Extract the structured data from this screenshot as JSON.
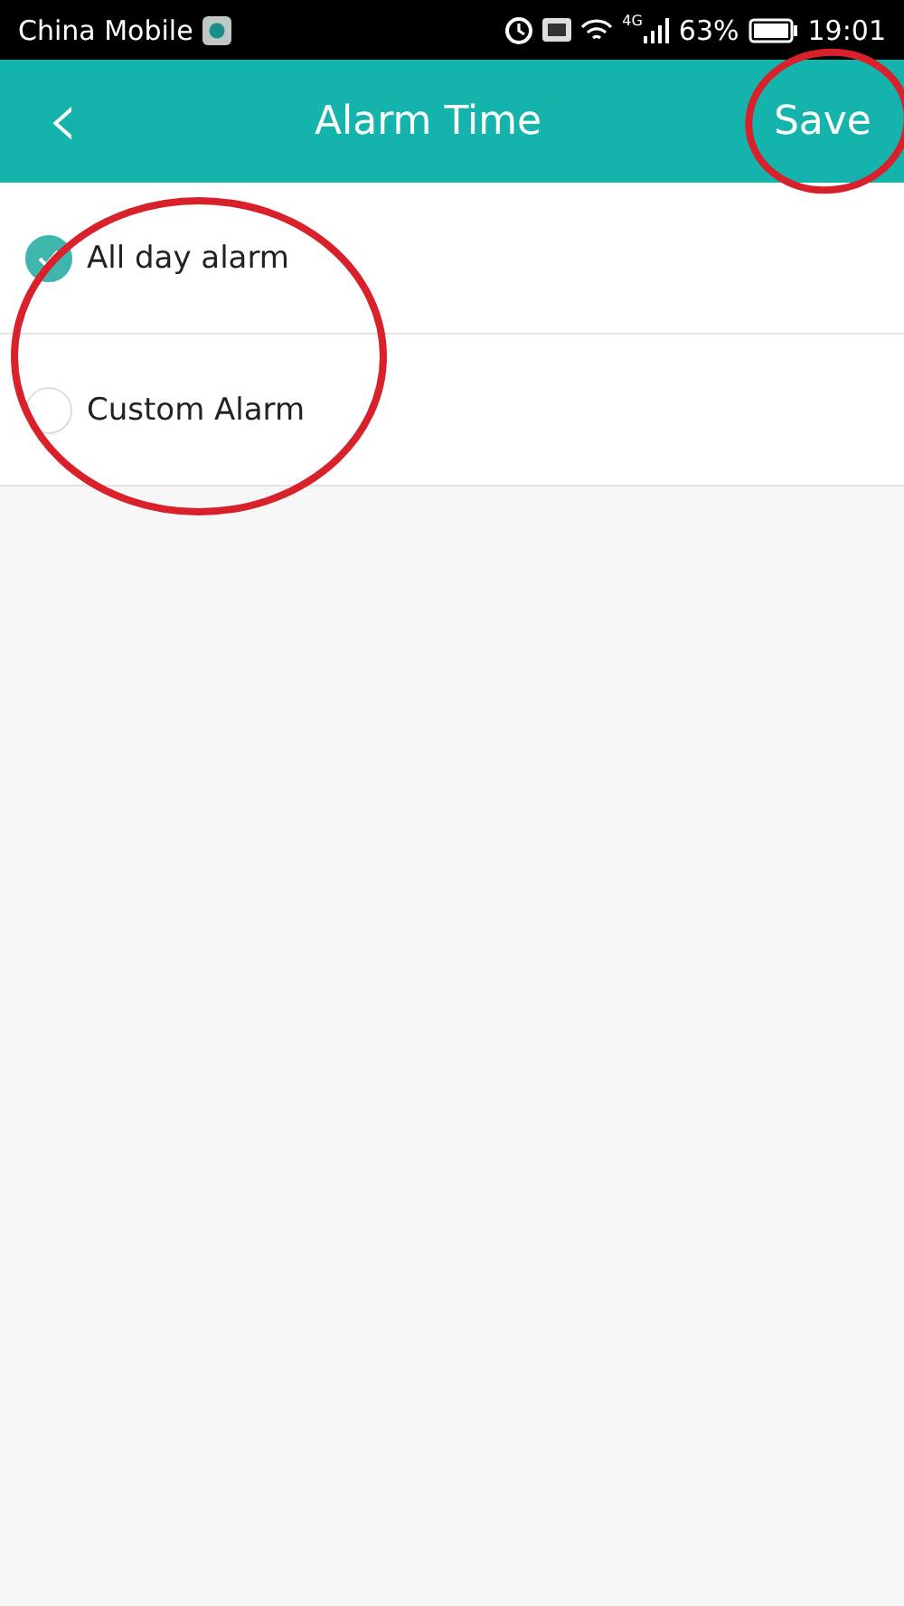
{
  "status_bar": {
    "carrier": "China Mobile",
    "network": "4G",
    "battery": "63%",
    "time": "19:01"
  },
  "header": {
    "back": "‹",
    "title": "Alarm Time",
    "action": "Save"
  },
  "options": [
    {
      "label": "All day alarm",
      "selected": true
    },
    {
      "label": "Custom Alarm",
      "selected": false
    }
  ],
  "annotations": [
    {
      "kind": "ellipse"
    },
    {
      "kind": "ellipse"
    }
  ]
}
